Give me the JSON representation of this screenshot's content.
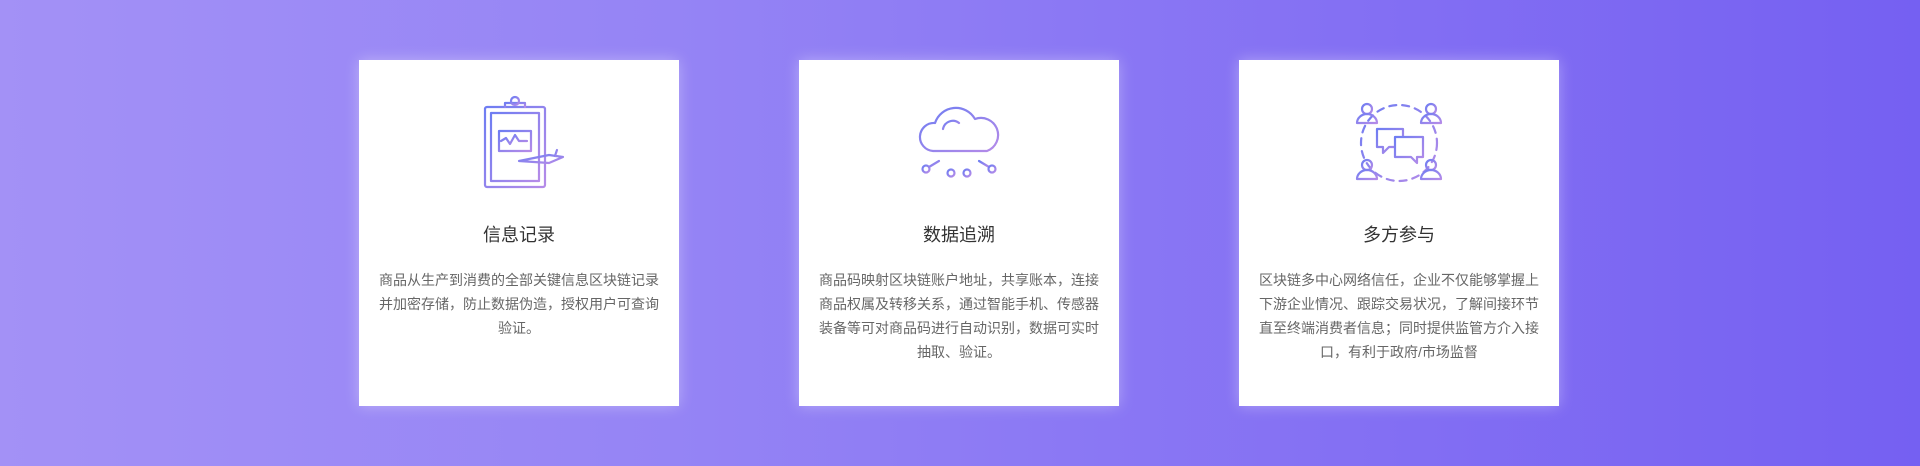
{
  "colors": {
    "background_start": "#a391f6",
    "background_end": "#7560f2",
    "icon_stroke_start": "#6e7df2",
    "icon_stroke_end": "#b58be8",
    "title": "#333333",
    "text": "#666666"
  },
  "features": [
    {
      "icon": "clipboard-record-icon",
      "title": "信息记录",
      "description": "商品从生产到消费的全部关键信息区块链记录并加密存储，防止数据伪造，授权用户可查询验证。"
    },
    {
      "icon": "cloud-network-icon",
      "title": "数据追溯",
      "description": "商品码映射区块链账户地址，共享账本，连接商品权属及转移关系，通过智能手机、传感器装备等可对商品码进行自动识别，数据可实时抽取、验证。"
    },
    {
      "icon": "multi-party-chat-icon",
      "title": "多方参与",
      "description": "区块链多中心网络信任，企业不仅能够掌握上下游企业情况、跟踪交易状况，了解间接环节直至终端消费者信息；同时提供监管方介入接口，有利于政府/市场监督"
    }
  ]
}
